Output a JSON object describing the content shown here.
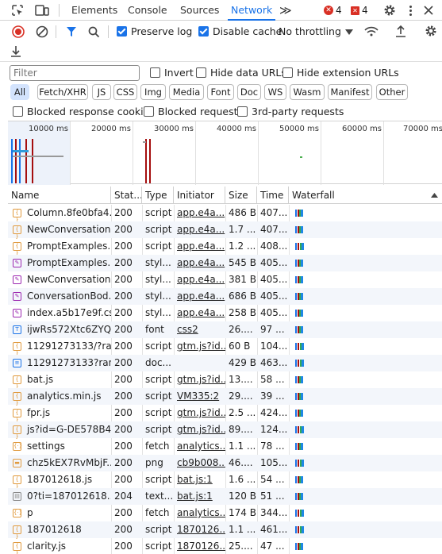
{
  "tabs": {
    "elements": "Elements",
    "console": "Console",
    "sources": "Sources",
    "network": "Network",
    "more": "≫"
  },
  "badges": {
    "errors": "4",
    "warnings": "4"
  },
  "toolbar": {
    "preserve_log": "Preserve log",
    "disable_cache": "Disable cache",
    "throttle": "No throttling"
  },
  "filter": {
    "placeholder": "Filter",
    "invert": "Invert",
    "hide_data": "Hide data URLs",
    "hide_ext": "Hide extension URLs"
  },
  "types": [
    "All",
    "Fetch/XHR",
    "JS",
    "CSS",
    "Img",
    "Media",
    "Font",
    "Doc",
    "WS",
    "Wasm",
    "Manifest",
    "Other"
  ],
  "options": {
    "blocked_cookies": "Blocked response cookies",
    "blocked_requests": "Blocked requests",
    "third_party": "3rd-party requests"
  },
  "timeline": [
    "10000 ms",
    "20000 ms",
    "30000 ms",
    "40000 ms",
    "50000 ms",
    "60000 ms",
    "70000 ms"
  ],
  "columns": {
    "name": "Name",
    "status": "Stat...",
    "type": "Type",
    "initiator": "Initiator",
    "size": "Size",
    "time": "Time",
    "waterfall": "Waterfall"
  },
  "rows": [
    {
      "icon": "script",
      "name": "Column.8fe0bfa4.js",
      "status": "200",
      "type": "script",
      "initiator": "app.e4a...",
      "size": "486 B",
      "time": "407..."
    },
    {
      "icon": "script",
      "name": "NewConversation...",
      "status": "200",
      "type": "script",
      "initiator": "app.e4a...",
      "size": "1.7 ...",
      "time": "407..."
    },
    {
      "icon": "script",
      "name": "PromptExamples...",
      "status": "200",
      "type": "script",
      "initiator": "app.e4a...",
      "size": "1.2 ...",
      "time": "408..."
    },
    {
      "icon": "style",
      "name": "PromptExamples....",
      "status": "200",
      "type": "styl...",
      "initiator": "app.e4a...",
      "size": "545 B",
      "time": "405..."
    },
    {
      "icon": "style",
      "name": "NewConversation....",
      "status": "200",
      "type": "styl...",
      "initiator": "app.e4a...",
      "size": "381 B",
      "time": "405..."
    },
    {
      "icon": "style",
      "name": "ConversationBod...",
      "status": "200",
      "type": "styl...",
      "initiator": "app.e4a...",
      "size": "686 B",
      "time": "405..."
    },
    {
      "icon": "style",
      "name": "index.a5b17e9f.css",
      "status": "200",
      "type": "styl...",
      "initiator": "app.e4a...",
      "size": "258 B",
      "time": "405..."
    },
    {
      "icon": "font",
      "name": "ijwRs572Xtc6ZYQ...",
      "status": "200",
      "type": "font",
      "initiator": "css2",
      "size": "26....",
      "time": "97 ..."
    },
    {
      "icon": "script",
      "name": "11291273133/?ra...",
      "status": "200",
      "type": "script",
      "initiator": "gtm.js?id...",
      "size": "60 B",
      "time": "104..."
    },
    {
      "icon": "doc",
      "name": "11291273133?ran...",
      "status": "200",
      "type": "doc...",
      "initiator": "",
      "size": "429 B",
      "time": "463..."
    },
    {
      "icon": "script",
      "name": "bat.js",
      "status": "200",
      "type": "script",
      "initiator": "gtm.js?id...",
      "size": "13....",
      "time": "58 ..."
    },
    {
      "icon": "script",
      "name": "analytics.min.js",
      "status": "200",
      "type": "script",
      "initiator": "VM335:2",
      "size": "29....",
      "time": "39 ..."
    },
    {
      "icon": "script",
      "name": "fpr.js",
      "status": "200",
      "type": "script",
      "initiator": "gtm.js?id...",
      "size": "2.5 ...",
      "time": "424..."
    },
    {
      "icon": "script",
      "name": "js?id=G-DE578B4...",
      "status": "200",
      "type": "script",
      "initiator": "gtm.js?id...",
      "size": "89....",
      "time": "124..."
    },
    {
      "icon": "fetch",
      "name": "settings",
      "status": "200",
      "type": "fetch",
      "initiator": "analytics...",
      "size": "1.1 ...",
      "time": "78 ..."
    },
    {
      "icon": "img",
      "name": "chz5kEX7RvMbjF...",
      "status": "200",
      "type": "png",
      "initiator": "cb9b008...",
      "size": "46....",
      "time": "105..."
    },
    {
      "icon": "script",
      "name": "187012618.js",
      "status": "200",
      "type": "script",
      "initiator": "bat.js:1",
      "size": "1.6 ...",
      "time": "54 ..."
    },
    {
      "icon": "text",
      "name": "0?ti=187012618...",
      "status": "204",
      "type": "text...",
      "initiator": "bat.js:1",
      "size": "120 B",
      "time": "51 ..."
    },
    {
      "icon": "fetch",
      "name": "p",
      "status": "200",
      "type": "fetch",
      "initiator": "analytics...",
      "size": "174 B",
      "time": "344..."
    },
    {
      "icon": "script",
      "name": "187012618",
      "status": "200",
      "type": "script",
      "initiator": "1870126...",
      "size": "1.1 ...",
      "time": "461..."
    },
    {
      "icon": "script",
      "name": "clarity.js",
      "status": "200",
      "type": "script",
      "initiator": "1870126...",
      "size": "25....",
      "time": "47 ..."
    }
  ]
}
